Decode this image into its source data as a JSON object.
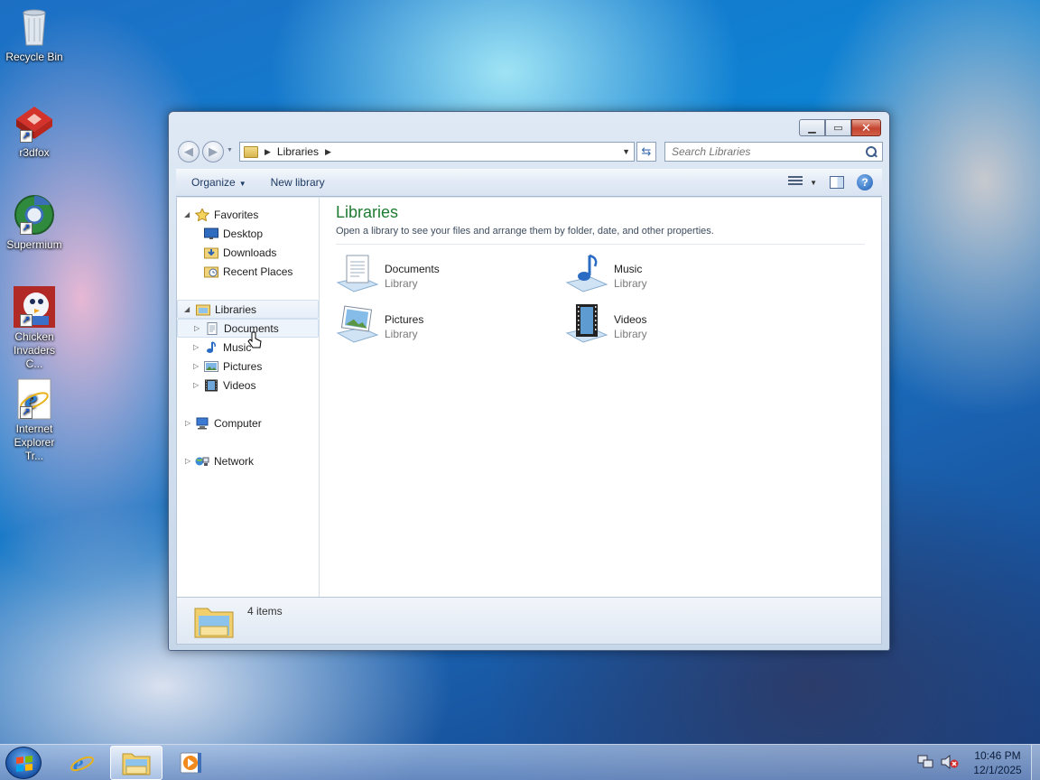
{
  "desktop": {
    "icons": [
      {
        "label": "Recycle Bin"
      },
      {
        "label": "r3dfox"
      },
      {
        "label": "Supermium"
      },
      {
        "label": "Chicken Invaders C..."
      },
      {
        "label": "Internet Explorer Tr..."
      }
    ]
  },
  "window": {
    "address": {
      "crumb": "Libraries"
    },
    "search": {
      "placeholder": "Search Libraries"
    },
    "toolbar": {
      "organize": "Organize",
      "new_library": "New library"
    },
    "nav": {
      "favorites": "Favorites",
      "desktop": "Desktop",
      "downloads": "Downloads",
      "recent_places": "Recent Places",
      "libraries": "Libraries",
      "documents": "Documents",
      "music": "Music",
      "pictures": "Pictures",
      "videos": "Videos",
      "computer": "Computer",
      "network": "Network"
    },
    "main": {
      "title": "Libraries",
      "description": "Open a library to see your files and arrange them by folder, date, and other properties.",
      "libraries": [
        {
          "name": "Documents",
          "type": "Library",
          "icon": "documents-library-icon"
        },
        {
          "name": "Music",
          "type": "Library",
          "icon": "music-library-icon"
        },
        {
          "name": "Pictures",
          "type": "Library",
          "icon": "pictures-library-icon"
        },
        {
          "name": "Videos",
          "type": "Library",
          "icon": "videos-library-icon"
        }
      ]
    },
    "details": {
      "count": "4 items"
    }
  },
  "taskbar": {
    "clock": {
      "time": "10:46 PM",
      "date": "12/1/2025"
    }
  },
  "colors": {
    "title_green": "#1e7b32",
    "accent": "#1f5fb5"
  }
}
